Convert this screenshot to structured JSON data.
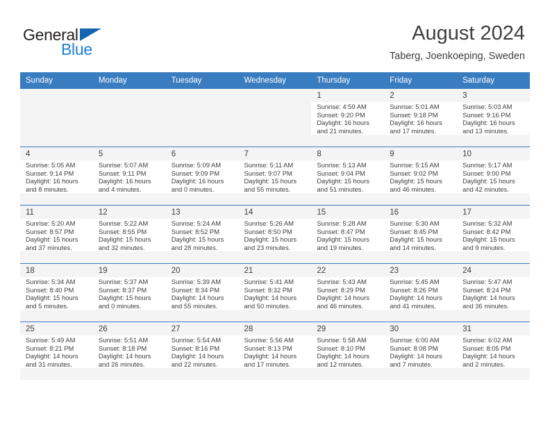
{
  "brand": {
    "name_top": "General",
    "name_bottom": "Blue",
    "accent_color": "#1b7fd4",
    "triangle_color": "#1565b0"
  },
  "header": {
    "month_title": "August 2024",
    "location": "Taberg, Joenkoeping, Sweden"
  },
  "calendar": {
    "header_bg": "#3a7cc0",
    "weekdays": [
      "Sunday",
      "Monday",
      "Tuesday",
      "Wednesday",
      "Thursday",
      "Friday",
      "Saturday"
    ],
    "weeks": [
      [
        {
          "day": "",
          "sunrise": "",
          "sunset": "",
          "daylight_line1": "",
          "daylight_line2": ""
        },
        {
          "day": "",
          "sunrise": "",
          "sunset": "",
          "daylight_line1": "",
          "daylight_line2": ""
        },
        {
          "day": "",
          "sunrise": "",
          "sunset": "",
          "daylight_line1": "",
          "daylight_line2": ""
        },
        {
          "day": "",
          "sunrise": "",
          "sunset": "",
          "daylight_line1": "",
          "daylight_line2": ""
        },
        {
          "day": "1",
          "sunrise": "Sunrise: 4:59 AM",
          "sunset": "Sunset: 9:20 PM",
          "daylight_line1": "Daylight: 16 hours",
          "daylight_line2": "and 21 minutes."
        },
        {
          "day": "2",
          "sunrise": "Sunrise: 5:01 AM",
          "sunset": "Sunset: 9:18 PM",
          "daylight_line1": "Daylight: 16 hours",
          "daylight_line2": "and 17 minutes."
        },
        {
          "day": "3",
          "sunrise": "Sunrise: 5:03 AM",
          "sunset": "Sunset: 9:16 PM",
          "daylight_line1": "Daylight: 16 hours",
          "daylight_line2": "and 13 minutes."
        }
      ],
      [
        {
          "day": "4",
          "sunrise": "Sunrise: 5:05 AM",
          "sunset": "Sunset: 9:14 PM",
          "daylight_line1": "Daylight: 16 hours",
          "daylight_line2": "and 8 minutes."
        },
        {
          "day": "5",
          "sunrise": "Sunrise: 5:07 AM",
          "sunset": "Sunset: 9:11 PM",
          "daylight_line1": "Daylight: 16 hours",
          "daylight_line2": "and 4 minutes."
        },
        {
          "day": "6",
          "sunrise": "Sunrise: 5:09 AM",
          "sunset": "Sunset: 9:09 PM",
          "daylight_line1": "Daylight: 16 hours",
          "daylight_line2": "and 0 minutes."
        },
        {
          "day": "7",
          "sunrise": "Sunrise: 5:11 AM",
          "sunset": "Sunset: 9:07 PM",
          "daylight_line1": "Daylight: 15 hours",
          "daylight_line2": "and 55 minutes."
        },
        {
          "day": "8",
          "sunrise": "Sunrise: 5:13 AM",
          "sunset": "Sunset: 9:04 PM",
          "daylight_line1": "Daylight: 15 hours",
          "daylight_line2": "and 51 minutes."
        },
        {
          "day": "9",
          "sunrise": "Sunrise: 5:15 AM",
          "sunset": "Sunset: 9:02 PM",
          "daylight_line1": "Daylight: 15 hours",
          "daylight_line2": "and 46 minutes."
        },
        {
          "day": "10",
          "sunrise": "Sunrise: 5:17 AM",
          "sunset": "Sunset: 9:00 PM",
          "daylight_line1": "Daylight: 15 hours",
          "daylight_line2": "and 42 minutes."
        }
      ],
      [
        {
          "day": "11",
          "sunrise": "Sunrise: 5:20 AM",
          "sunset": "Sunset: 8:57 PM",
          "daylight_line1": "Daylight: 15 hours",
          "daylight_line2": "and 37 minutes."
        },
        {
          "day": "12",
          "sunrise": "Sunrise: 5:22 AM",
          "sunset": "Sunset: 8:55 PM",
          "daylight_line1": "Daylight: 15 hours",
          "daylight_line2": "and 32 minutes."
        },
        {
          "day": "13",
          "sunrise": "Sunrise: 5:24 AM",
          "sunset": "Sunset: 8:52 PM",
          "daylight_line1": "Daylight: 15 hours",
          "daylight_line2": "and 28 minutes."
        },
        {
          "day": "14",
          "sunrise": "Sunrise: 5:26 AM",
          "sunset": "Sunset: 8:50 PM",
          "daylight_line1": "Daylight: 15 hours",
          "daylight_line2": "and 23 minutes."
        },
        {
          "day": "15",
          "sunrise": "Sunrise: 5:28 AM",
          "sunset": "Sunset: 8:47 PM",
          "daylight_line1": "Daylight: 15 hours",
          "daylight_line2": "and 19 minutes."
        },
        {
          "day": "16",
          "sunrise": "Sunrise: 5:30 AM",
          "sunset": "Sunset: 8:45 PM",
          "daylight_line1": "Daylight: 15 hours",
          "daylight_line2": "and 14 minutes."
        },
        {
          "day": "17",
          "sunrise": "Sunrise: 5:32 AM",
          "sunset": "Sunset: 8:42 PM",
          "daylight_line1": "Daylight: 15 hours",
          "daylight_line2": "and 9 minutes."
        }
      ],
      [
        {
          "day": "18",
          "sunrise": "Sunrise: 5:34 AM",
          "sunset": "Sunset: 8:40 PM",
          "daylight_line1": "Daylight: 15 hours",
          "daylight_line2": "and 5 minutes."
        },
        {
          "day": "19",
          "sunrise": "Sunrise: 5:37 AM",
          "sunset": "Sunset: 8:37 PM",
          "daylight_line1": "Daylight: 15 hours",
          "daylight_line2": "and 0 minutes."
        },
        {
          "day": "20",
          "sunrise": "Sunrise: 5:39 AM",
          "sunset": "Sunset: 8:34 PM",
          "daylight_line1": "Daylight: 14 hours",
          "daylight_line2": "and 55 minutes."
        },
        {
          "day": "21",
          "sunrise": "Sunrise: 5:41 AM",
          "sunset": "Sunset: 8:32 PM",
          "daylight_line1": "Daylight: 14 hours",
          "daylight_line2": "and 50 minutes."
        },
        {
          "day": "22",
          "sunrise": "Sunrise: 5:43 AM",
          "sunset": "Sunset: 8:29 PM",
          "daylight_line1": "Daylight: 14 hours",
          "daylight_line2": "and 46 minutes."
        },
        {
          "day": "23",
          "sunrise": "Sunrise: 5:45 AM",
          "sunset": "Sunset: 8:26 PM",
          "daylight_line1": "Daylight: 14 hours",
          "daylight_line2": "and 41 minutes."
        },
        {
          "day": "24",
          "sunrise": "Sunrise: 5:47 AM",
          "sunset": "Sunset: 8:24 PM",
          "daylight_line1": "Daylight: 14 hours",
          "daylight_line2": "and 36 minutes."
        }
      ],
      [
        {
          "day": "25",
          "sunrise": "Sunrise: 5:49 AM",
          "sunset": "Sunset: 8:21 PM",
          "daylight_line1": "Daylight: 14 hours",
          "daylight_line2": "and 31 minutes."
        },
        {
          "day": "26",
          "sunrise": "Sunrise: 5:51 AM",
          "sunset": "Sunset: 8:18 PM",
          "daylight_line1": "Daylight: 14 hours",
          "daylight_line2": "and 26 minutes."
        },
        {
          "day": "27",
          "sunrise": "Sunrise: 5:54 AM",
          "sunset": "Sunset: 8:16 PM",
          "daylight_line1": "Daylight: 14 hours",
          "daylight_line2": "and 22 minutes."
        },
        {
          "day": "28",
          "sunrise": "Sunrise: 5:56 AM",
          "sunset": "Sunset: 8:13 PM",
          "daylight_line1": "Daylight: 14 hours",
          "daylight_line2": "and 17 minutes."
        },
        {
          "day": "29",
          "sunrise": "Sunrise: 5:58 AM",
          "sunset": "Sunset: 8:10 PM",
          "daylight_line1": "Daylight: 14 hours",
          "daylight_line2": "and 12 minutes."
        },
        {
          "day": "30",
          "sunrise": "Sunrise: 6:00 AM",
          "sunset": "Sunset: 8:08 PM",
          "daylight_line1": "Daylight: 14 hours",
          "daylight_line2": "and 7 minutes."
        },
        {
          "day": "31",
          "sunrise": "Sunrise: 6:02 AM",
          "sunset": "Sunset: 8:05 PM",
          "daylight_line1": "Daylight: 14 hours",
          "daylight_line2": "and 2 minutes."
        }
      ]
    ]
  }
}
